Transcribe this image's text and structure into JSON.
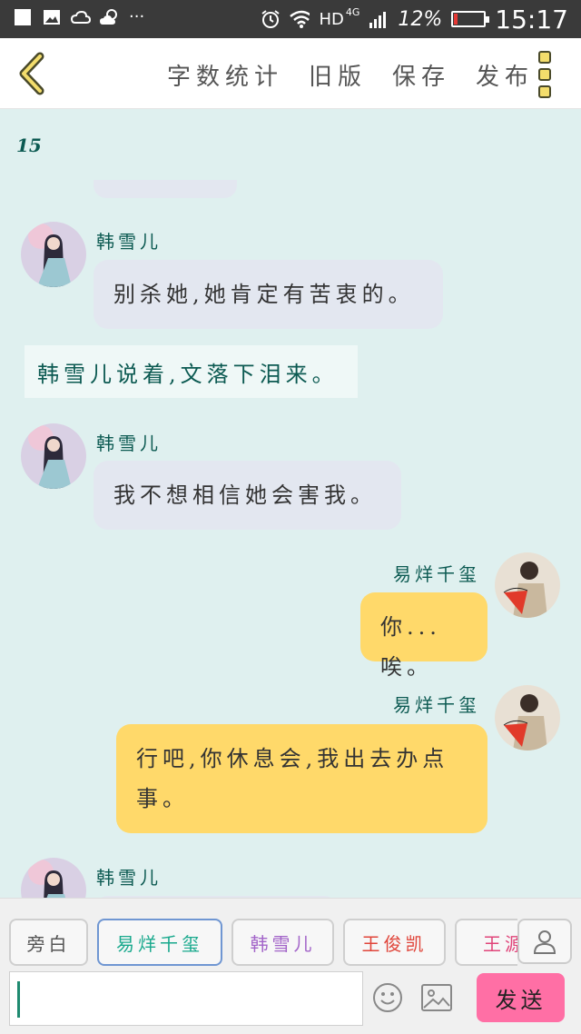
{
  "status_bar": {
    "left_icons": [
      "notification-square-icon",
      "image-icon",
      "cloud-icon",
      "weather-icon"
    ],
    "more": "···",
    "right_icons": [
      "alarm-icon",
      "wifi-icon",
      "signal-icon",
      "battery-icon"
    ],
    "network": "HD",
    "network_type": "4G",
    "battery_percent": "12%",
    "battery_level": 0.12,
    "battery_color": "#e53935",
    "time": "15:17"
  },
  "header": {
    "back_icon": "chevron-left-icon",
    "actions": [
      "字数统计",
      "旧版",
      "保存",
      "发布"
    ],
    "more_icon": "three-squares-menu-icon"
  },
  "chat": {
    "word_count": "15",
    "narration": "韩雪儿说着,文落下泪来。",
    "messages": [
      {
        "side": "left",
        "name": "韩雪儿",
        "text": "别杀她,她肯定有苦衷的。"
      },
      {
        "side": "left",
        "name": "韩雪儿",
        "text": "我不想相信她会害我。"
      },
      {
        "side": "right",
        "name": "易烊千玺",
        "text": "你...唉。"
      },
      {
        "side": "right",
        "name": "易烊千玺",
        "text": "行吧,你休息会,我出去办点事。"
      },
      {
        "side": "left",
        "name": "韩雪儿",
        "text": ""
      }
    ]
  },
  "bottom": {
    "roles": [
      {
        "label": "旁白",
        "color": "#555555"
      },
      {
        "label": "易烊千玺",
        "color": "#19a98d"
      },
      {
        "label": "韩雪儿",
        "color": "#a365c9"
      },
      {
        "label": "王俊凯",
        "color": "#e0453a"
      },
      {
        "label": "王源",
        "color": "#e0457a"
      }
    ],
    "profile_icon": "person-icon",
    "input_value": "",
    "emoji_icon": "smiley-icon",
    "image_icon": "picture-icon",
    "send_label": "发送",
    "send_color": "#ff6fa5"
  }
}
